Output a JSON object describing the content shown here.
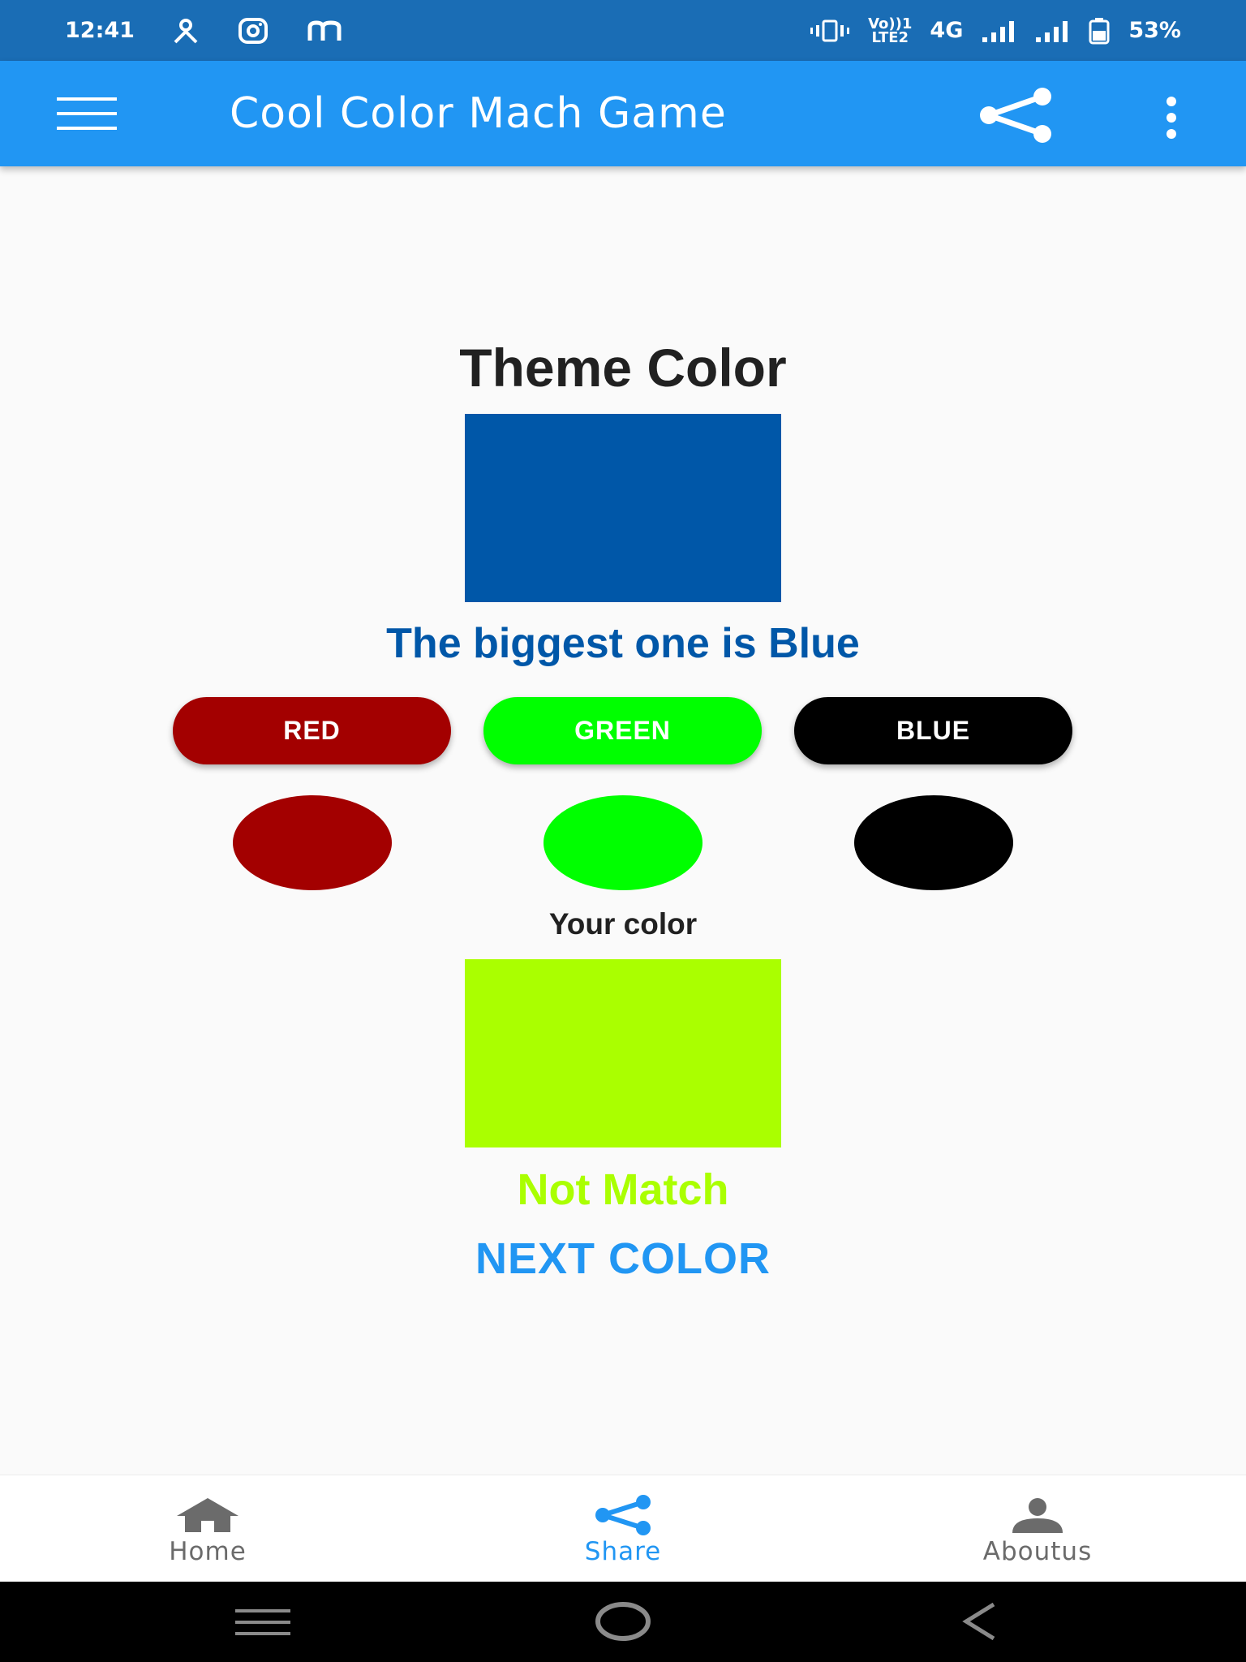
{
  "status_bar": {
    "time": "12:41",
    "left_icons": [
      "person-icon",
      "instagram-icon",
      "m-app-icon"
    ],
    "volte_line1": "Vo))1",
    "volte_line2": "LTE2",
    "network": "4G",
    "battery": "53%"
  },
  "app_bar": {
    "title": "Cool Color Mach Game",
    "icons": [
      "menu-icon",
      "share-icon",
      "more-vert-icon"
    ]
  },
  "game": {
    "theme_title": "Theme Color",
    "theme_color": "#0057a8",
    "hint": "The biggest one is Blue",
    "hint_color": "#0057a8",
    "buttons": [
      {
        "label": "RED",
        "color": "#a30000"
      },
      {
        "label": "GREEN",
        "color": "#00ff00"
      },
      {
        "label": "BLUE",
        "color": "#000000"
      }
    ],
    "dots": [
      "#a30000",
      "#00ff00",
      "#000000"
    ],
    "your_color_label": "Your color",
    "your_color": "#aaff00",
    "result": "Not Match",
    "result_color": "#aaff00",
    "next_label": "NEXT COLOR",
    "next_color": "#2196f3"
  },
  "bottom_nav": {
    "items": [
      {
        "label": "Home",
        "icon": "home-icon",
        "active": false
      },
      {
        "label": "Share",
        "icon": "share-icon",
        "active": true
      },
      {
        "label": "Aboutus",
        "icon": "person-icon",
        "active": false
      }
    ],
    "active_color": "#2196f3",
    "inactive_color": "#6b6b6b"
  },
  "system_nav": {
    "icons": [
      "recents-icon",
      "home-circle-icon",
      "back-icon"
    ]
  }
}
